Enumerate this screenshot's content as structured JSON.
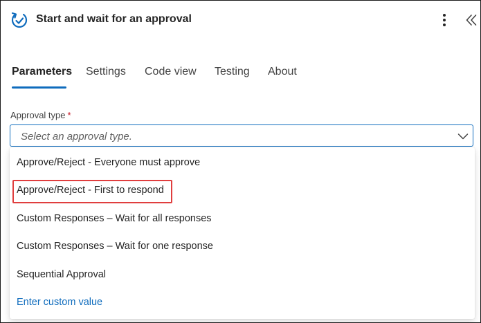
{
  "header": {
    "title": "Start and wait for an approval",
    "icon": "approval-refresh-icon",
    "more_icon": "more-vertical-icon",
    "collapse_icon": "double-chevron-left-icon"
  },
  "tabs": [
    {
      "label": "Parameters",
      "active": true
    },
    {
      "label": "Settings",
      "active": false
    },
    {
      "label": "Code view",
      "active": false
    },
    {
      "label": "Testing",
      "active": false
    },
    {
      "label": "About",
      "active": false
    }
  ],
  "approval_type": {
    "label": "Approval type",
    "required_mark": "*",
    "placeholder": "Select an approval type.",
    "options": [
      {
        "label": "Approve/Reject - Everyone must approve"
      },
      {
        "label": "Approve/Reject - First to respond",
        "highlighted": true
      },
      {
        "label": "Custom Responses – Wait for all responses"
      },
      {
        "label": "Custom Responses – Wait for one response"
      },
      {
        "label": "Sequential Approval"
      },
      {
        "label": "Enter custom value",
        "link": true
      }
    ]
  },
  "colors": {
    "accent": "#0f6cbd",
    "highlight_border": "#e03e3e",
    "required": "#c50f1f"
  }
}
